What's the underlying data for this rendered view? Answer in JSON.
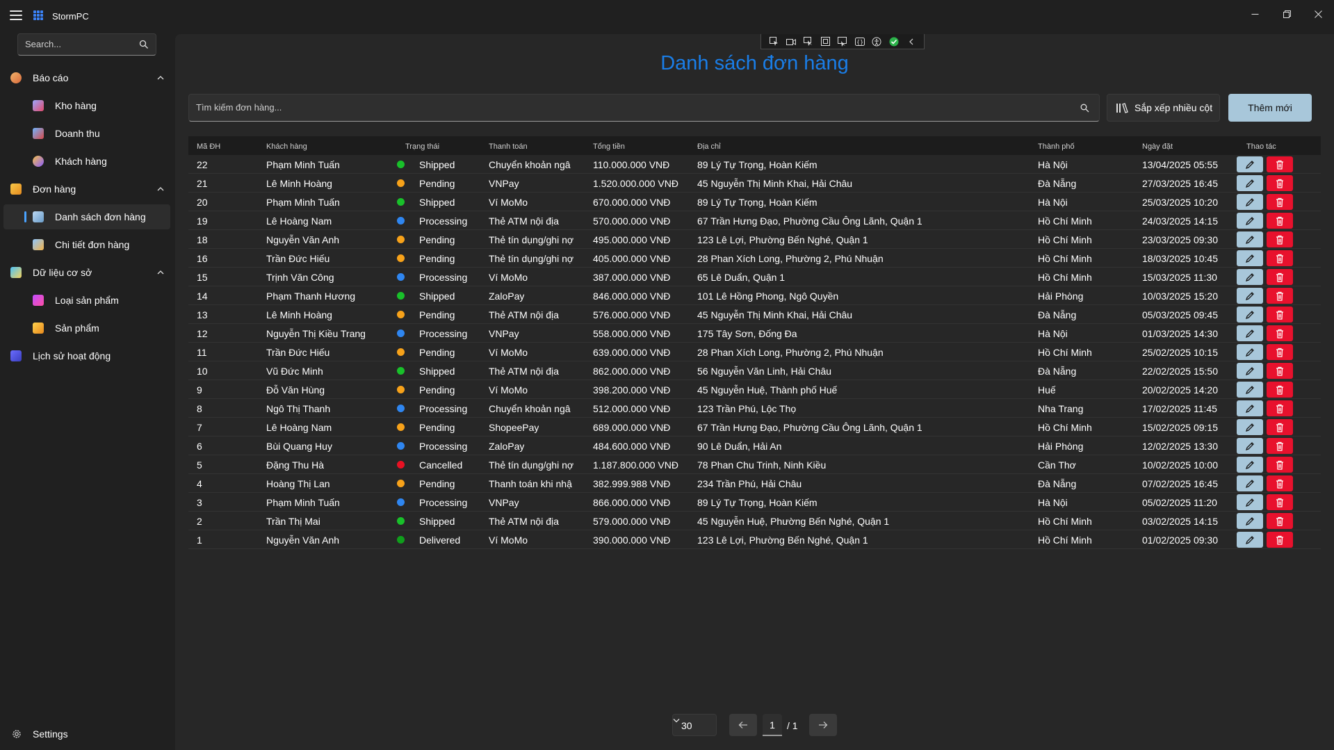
{
  "window": {
    "title": "StormPC"
  },
  "sidebar": {
    "search_placeholder": "Search...",
    "groups": [
      {
        "label": "Báo cáo",
        "items": [
          "Kho hàng",
          "Doanh thu",
          "Khách hàng"
        ]
      },
      {
        "label": "Đơn hàng",
        "items": [
          "Danh sách đơn hàng",
          "Chi tiết đơn hàng"
        ]
      },
      {
        "label": "Dữ liệu cơ sở",
        "items": [
          "Loại sản phẩm",
          "Sản phẩm"
        ]
      }
    ],
    "history_label": "Lịch sử hoạt động",
    "settings_label": "Settings",
    "active_item": "Danh sách đơn hàng"
  },
  "main": {
    "title": "Danh sách đơn hàng",
    "search_placeholder": "Tìm kiếm đơn hàng...",
    "sort_label": "Sắp xếp nhiều cột",
    "add_label": "Thêm mới"
  },
  "table": {
    "columns": [
      "Mã ĐH",
      "Khách hàng",
      "Trạng thái",
      "Thanh toán",
      "Tổng tiền",
      "Địa chỉ",
      "Thành phố",
      "Ngày đặt",
      "Thao tác"
    ],
    "status_colors": {
      "Shipped": "#19c02a",
      "Pending": "#f7a21a",
      "Processing": "#2f86f0",
      "Cancelled": "#e81123",
      "Delivered": "#109e1c"
    },
    "rows": [
      [
        "22",
        "Phạm Minh Tuấn",
        "Shipped",
        "Chuyển khoản ngâ",
        "110.000.000 VNĐ",
        "89 Lý Tự Trọng, Hoàn Kiếm",
        "Hà Nội",
        "13/04/2025 05:55"
      ],
      [
        "21",
        "Lê Minh Hoàng",
        "Pending",
        "VNPay",
        "1.520.000.000 VNĐ",
        "45 Nguyễn Thị Minh Khai, Hải Châu",
        "Đà Nẵng",
        "27/03/2025 16:45"
      ],
      [
        "20",
        "Phạm Minh Tuấn",
        "Shipped",
        "Ví MoMo",
        "670.000.000 VNĐ",
        "89 Lý Tự Trọng, Hoàn Kiếm",
        "Hà Nội",
        "25/03/2025 10:20"
      ],
      [
        "19",
        "Lê Hoàng Nam",
        "Processing",
        "Thẻ ATM nội địa",
        "570.000.000 VNĐ",
        "67 Trần Hưng Đạo, Phường Cầu Ông Lãnh, Quận 1",
        "Hồ Chí Minh",
        "24/03/2025 14:15"
      ],
      [
        "18",
        "Nguyễn Văn Anh",
        "Pending",
        "Thẻ tín dụng/ghi nợ",
        "495.000.000 VNĐ",
        "123 Lê Lợi, Phường Bến Nghé, Quận 1",
        "Hồ Chí Minh",
        "23/03/2025 09:30"
      ],
      [
        "16",
        "Trần Đức Hiếu",
        "Pending",
        "Thẻ tín dụng/ghi nợ",
        "405.000.000 VNĐ",
        "28 Phan Xích Long, Phường 2, Phú Nhuận",
        "Hồ Chí Minh",
        "18/03/2025 10:45"
      ],
      [
        "15",
        "Trịnh Văn Công",
        "Processing",
        "Ví MoMo",
        "387.000.000 VNĐ",
        "65 Lê Duẩn, Quận 1",
        "Hồ Chí Minh",
        "15/03/2025 11:30"
      ],
      [
        "14",
        "Phạm Thanh Hương",
        "Shipped",
        "ZaloPay",
        "846.000.000 VNĐ",
        "101 Lê Hồng Phong, Ngô Quyền",
        "Hải Phòng",
        "10/03/2025 15:20"
      ],
      [
        "13",
        "Lê Minh Hoàng",
        "Pending",
        "Thẻ ATM nội địa",
        "576.000.000 VNĐ",
        "45 Nguyễn Thị Minh Khai, Hải Châu",
        "Đà Nẵng",
        "05/03/2025 09:45"
      ],
      [
        "12",
        "Nguyễn Thị Kiều Trang",
        "Processing",
        "VNPay",
        "558.000.000 VNĐ",
        "175 Tây Sơn, Đống Đa",
        "Hà Nội",
        "01/03/2025 14:30"
      ],
      [
        "11",
        "Trần Đức Hiếu",
        "Pending",
        "Ví MoMo",
        "639.000.000 VNĐ",
        "28 Phan Xích Long, Phường 2, Phú Nhuận",
        "Hồ Chí Minh",
        "25/02/2025 10:15"
      ],
      [
        "10",
        "Vũ Đức Minh",
        "Shipped",
        "Thẻ ATM nội địa",
        "862.000.000 VNĐ",
        "56 Nguyễn Văn Linh, Hải Châu",
        "Đà Nẵng",
        "22/02/2025 15:50"
      ],
      [
        "9",
        "Đỗ Văn Hùng",
        "Pending",
        "Ví MoMo",
        "398.200.000 VNĐ",
        "45 Nguyễn Huệ, Thành phố Huế",
        "Huế",
        "20/02/2025 14:20"
      ],
      [
        "8",
        "Ngô Thị Thanh",
        "Processing",
        "Chuyển khoản ngâ",
        "512.000.000 VNĐ",
        "123 Trần Phú, Lộc Thọ",
        "Nha Trang",
        "17/02/2025 11:45"
      ],
      [
        "7",
        "Lê Hoàng Nam",
        "Pending",
        "ShopeePay",
        "689.000.000 VNĐ",
        "67 Trần Hưng Đạo, Phường Cầu Ông Lãnh, Quận 1",
        "Hồ Chí Minh",
        "15/02/2025 09:15"
      ],
      [
        "6",
        "Bùi Quang Huy",
        "Processing",
        "ZaloPay",
        "484.600.000 VNĐ",
        "90 Lê Duẩn, Hải An",
        "Hải Phòng",
        "12/02/2025 13:30"
      ],
      [
        "5",
        "Đặng Thu Hà",
        "Cancelled",
        "Thẻ tín dụng/ghi nợ",
        "1.187.800.000 VNĐ",
        "78 Phan Chu Trinh, Ninh Kiều",
        "Cần Thơ",
        "10/02/2025 10:00"
      ],
      [
        "4",
        "Hoàng Thị Lan",
        "Pending",
        "Thanh toán khi nhậ",
        "382.999.988 VNĐ",
        "234 Trần Phú, Hải Châu",
        "Đà Nẵng",
        "07/02/2025 16:45"
      ],
      [
        "3",
        "Phạm Minh Tuấn",
        "Processing",
        "VNPay",
        "866.000.000 VNĐ",
        "89 Lý Tự Trọng, Hoàn Kiếm",
        "Hà Nội",
        "05/02/2025 11:20"
      ],
      [
        "2",
        "Trần Thị Mai",
        "Shipped",
        "Thẻ ATM nội địa",
        "579.000.000 VNĐ",
        "45 Nguyễn Huệ, Phường Bến Nghé, Quận 1",
        "Hồ Chí Minh",
        "03/02/2025 14:15"
      ],
      [
        "1",
        "Nguyễn Văn Anh",
        "Delivered",
        "Ví MoMo",
        "390.000.000 VNĐ",
        "123 Lê Lợi, Phường Bến Nghé, Quận 1",
        "Hồ Chí Minh",
        "01/02/2025 09:30"
      ]
    ]
  },
  "pager": {
    "page_size": "30",
    "current_page": "1",
    "total": "/ 1"
  }
}
